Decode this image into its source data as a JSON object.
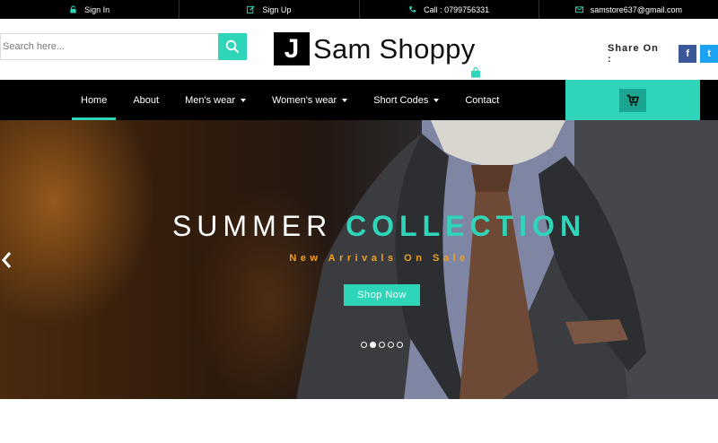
{
  "topbar": {
    "items": [
      {
        "label": "Sign In",
        "icon": "unlock-icon"
      },
      {
        "label": "Sign Up",
        "icon": "edit-icon"
      },
      {
        "label": "Call : 0799756331",
        "icon": "phone-icon"
      },
      {
        "label": "samstore637@gmail.com",
        "icon": "envelope-icon"
      }
    ]
  },
  "search": {
    "placeholder": "Search here...",
    "value": ""
  },
  "logo": {
    "mark": "J",
    "text": "Sam Shoppy"
  },
  "share": {
    "label": "Share On :",
    "facebook": "f",
    "twitter": "t"
  },
  "nav": {
    "items": [
      {
        "label": "Home",
        "dropdown": false,
        "active": true
      },
      {
        "label": "About",
        "dropdown": false,
        "active": false
      },
      {
        "label": "Men's wear",
        "dropdown": true,
        "active": false
      },
      {
        "label": "Women's wear",
        "dropdown": true,
        "active": false
      },
      {
        "label": "Short Codes",
        "dropdown": true,
        "active": false
      },
      {
        "label": "Contact",
        "dropdown": false,
        "active": false
      }
    ]
  },
  "hero": {
    "title_main": "SUMMER",
    "title_accent": "COLLECTION",
    "subtitle": "New Arrivals On Sale",
    "button": "Shop Now",
    "slides": 5,
    "current_slide": 2
  },
  "colors": {
    "accent": "#2fd5b8",
    "subtitle": "#f0a020",
    "bar": "#000000"
  }
}
